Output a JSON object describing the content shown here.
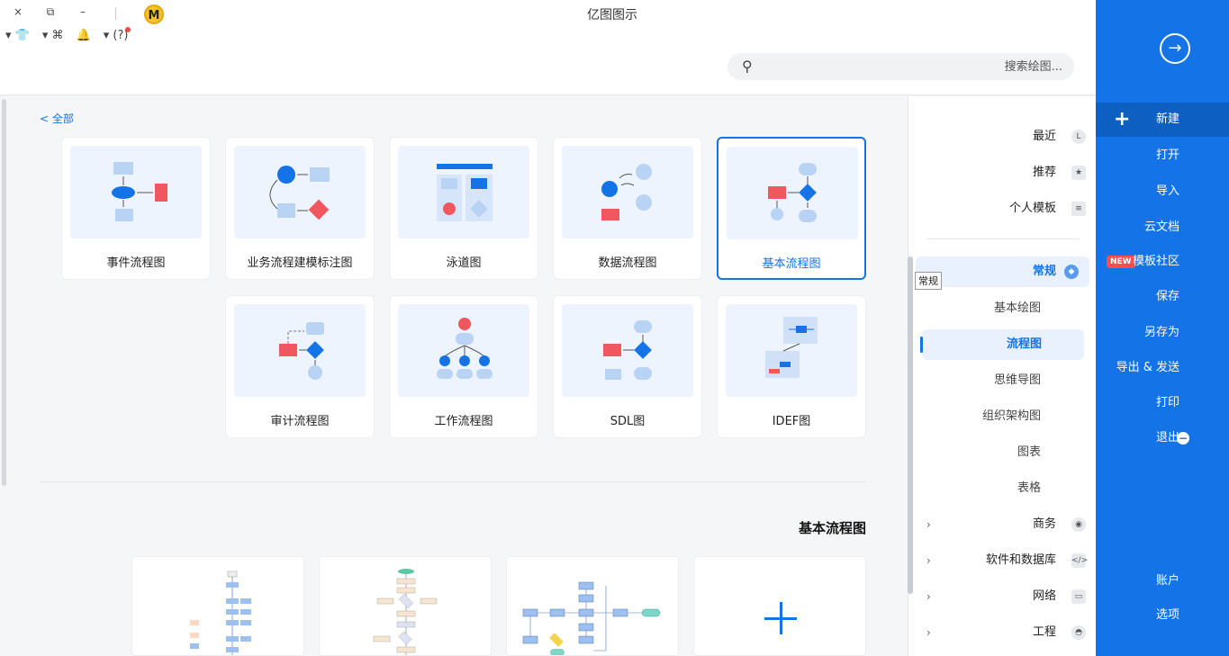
{
  "window": {
    "title": "亿图图示",
    "close": "×",
    "restore": "⧉",
    "minimize": "–",
    "avatar_letter": "M"
  },
  "toolbar": {
    "shirt": "👕",
    "apps": "⌘",
    "bell": "🔔",
    "help": "?"
  },
  "search": {
    "placeholder": "搜索绘图..."
  },
  "breadcrumb": "< 全部",
  "templates": [
    {
      "label": "事件流程图"
    },
    {
      "label": "业务流程建模标注图"
    },
    {
      "label": "泳道图"
    },
    {
      "label": "数据流程图"
    },
    {
      "label": "基本流程图",
      "active": true
    },
    {
      "label": "审计流程图"
    },
    {
      "label": "工作流程图"
    },
    {
      "label": "SDL图"
    },
    {
      "label": "IDEF图"
    }
  ],
  "section_title": "基本流程图",
  "category_nav": {
    "recent": "最近",
    "recommend": "推荐",
    "personal": "个人模板",
    "general": "常规",
    "tooltip": "常规",
    "subs": [
      "基本绘图",
      "流程图",
      "思维导图",
      "组织架构图",
      "图表",
      "表格"
    ],
    "groups": [
      "商务",
      "软件和数据库",
      "网络",
      "工程"
    ]
  },
  "right_menu": {
    "new": "新建",
    "open": "打开",
    "import": "导入",
    "cloud": "云文档",
    "community": "模板社区",
    "new_badge": "NEW",
    "save": "保存",
    "save_as": "另存为",
    "export": "导出 & 发送",
    "print": "打印",
    "exit": "退出",
    "account": "账户",
    "options": "选项"
  },
  "colors": {
    "accent": "#1473e6",
    "shape_blue": "#1473e6",
    "shape_light": "#b9d3f5",
    "shape_red": "#f0575f"
  }
}
